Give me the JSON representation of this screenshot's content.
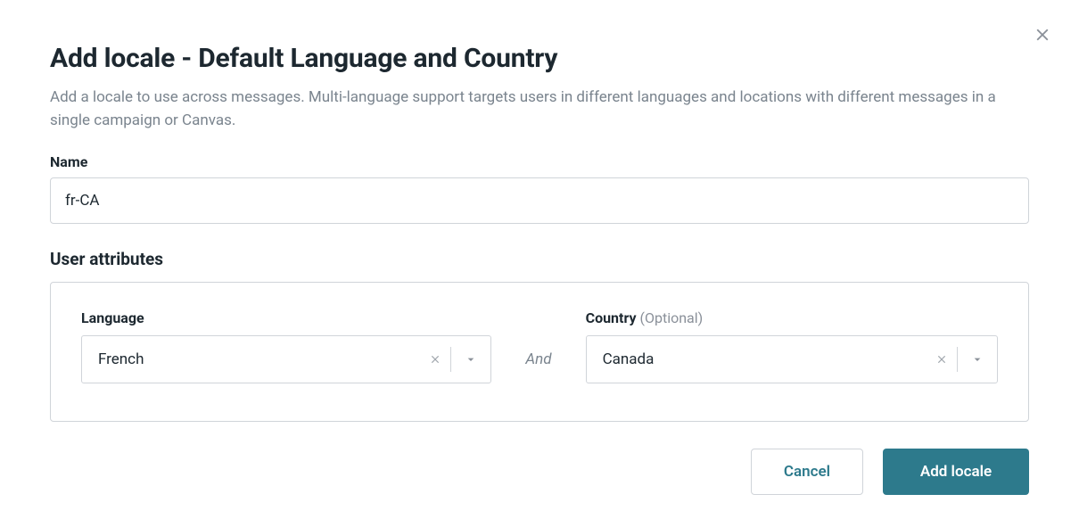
{
  "modal": {
    "title": "Add locale - Default Language and Country",
    "description": "Add a locale to use across messages. Multi-language support targets users in different languages and locations with different messages in a single campaign or Canvas."
  },
  "name": {
    "label": "Name",
    "value": "fr-CA"
  },
  "user_attributes": {
    "label": "User attributes",
    "language": {
      "label": "Language",
      "value": "French"
    },
    "conjunction": "And",
    "country": {
      "label": "Country",
      "optional_hint": "(Optional)",
      "value": "Canada"
    }
  },
  "footer": {
    "cancel_label": "Cancel",
    "submit_label": "Add locale"
  }
}
